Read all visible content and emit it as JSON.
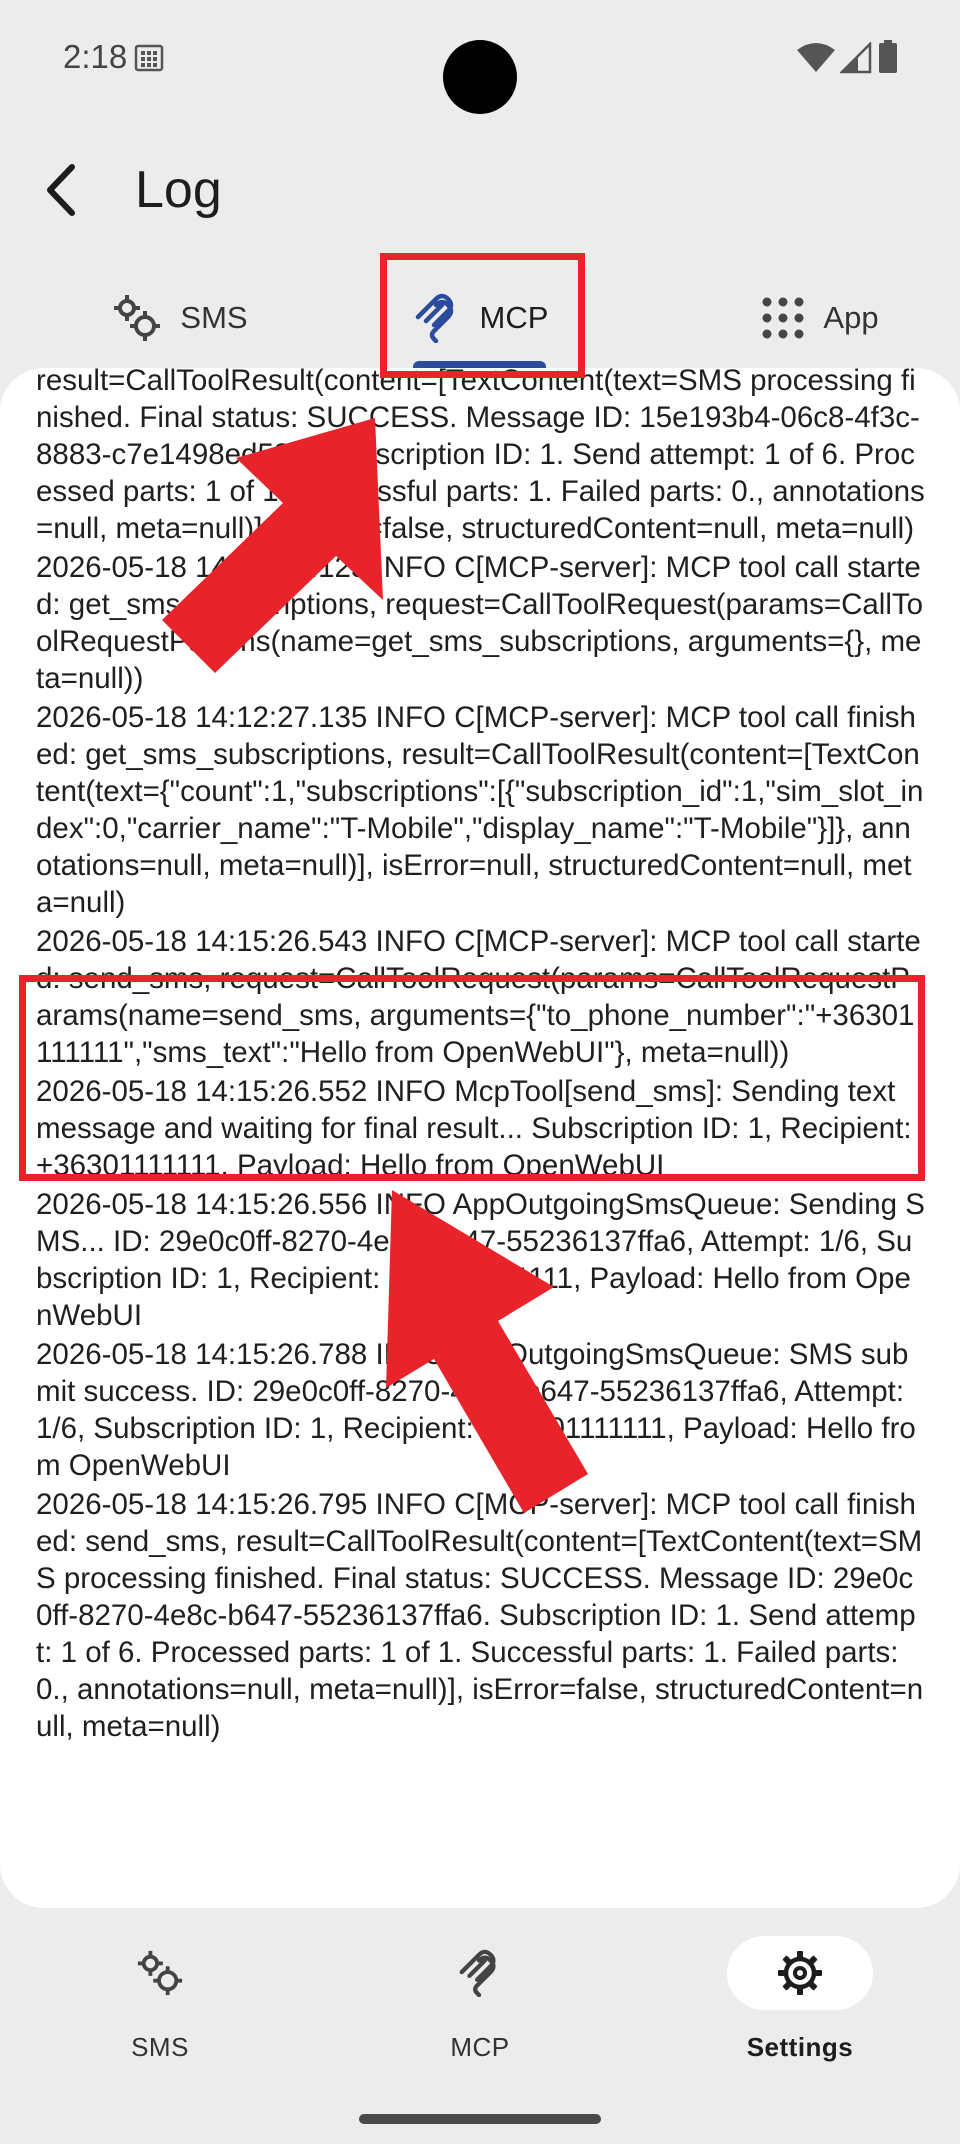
{
  "status_bar": {
    "time": "2:18"
  },
  "app_bar": {
    "title": "Log"
  },
  "tabs": [
    {
      "label": "SMS",
      "icon": "gears-icon"
    },
    {
      "label": "MCP",
      "icon": "mcp-logo-icon",
      "selected": true
    },
    {
      "label": "App",
      "icon": "grid-dots-icon"
    }
  ],
  "log_entries": [
    "result=CallToolResult(content=[TextContent(text=SMS processing finished. Final status: SUCCESS. Message ID: 15e193b4-06c8-4f3c-8883-c7e1498ed539. Subscription ID: 1. Send attempt: 1 of 6. Processed parts: 1 of 1. Successful parts: 1. Failed parts: 0., annotations=null, meta=null)], isError=false, structuredContent=null, meta=null)",
    "2026-05-18 14:12:27.125 INFO C[MCP-server]: MCP tool call started: get_sms_subscriptions, request=CallToolRequest(params=CallToolRequestParams(name=get_sms_subscriptions, arguments={}, meta=null))",
    "2026-05-18 14:12:27.135 INFO C[MCP-server]: MCP tool call finished: get_sms_subscriptions, result=CallToolResult(content=[TextContent(text={\"count\":1,\"subscriptions\":[{\"subscription_id\":1,\"sim_slot_index\":0,\"carrier_name\":\"T-Mobile\",\"display_name\":\"T-Mobile\"}]}, annotations=null, meta=null)], isError=null, structuredContent=null, meta=null)",
    "2026-05-18 14:15:26.543 INFO C[MCP-server]: MCP tool call started: send_sms, request=CallToolRequest(params=CallToolRequestParams(name=send_sms, arguments={\"to_phone_number\":\"+36301111111\",\"sms_text\":\"Hello from OpenWebUI\"}, meta=null))",
    "2026-05-18 14:15:26.552 INFO McpTool[send_sms]: Sending text message and waiting for final result... Subscription ID: 1, Recipient: +36301111111, Payload: Hello from OpenWebUI",
    "2026-05-18 14:15:26.556 INFO AppOutgoingSmsQueue: Sending SMS... ID: 29e0c0ff-8270-4e8c-b647-55236137ffa6, Attempt: 1/6, Subscription ID: 1, Recipient: +36301111111, Payload: Hello from OpenWebUI",
    "2026-05-18 14:15:26.788 INFO AppOutgoingSmsQueue: SMS submit success. ID: 29e0c0ff-8270-4e8c-b647-55236137ffa6, Attempt: 1/6, Subscription ID: 1, Recipient: +36301111111, Payload: Hello from OpenWebUI",
    "2026-05-18 14:15:26.795 INFO C[MCP-server]: MCP tool call finished: send_sms, result=CallToolResult(content=[TextContent(text=SMS processing finished. Final status: SUCCESS. Message ID: 29e0c0ff-8270-4e8c-b647-55236137ffa6. Subscription ID: 1. Send attempt: 1 of 6. Processed parts: 1 of 1. Successful parts: 1. Failed parts: 0., annotations=null, meta=null)], isError=false, structuredContent=null, meta=null)"
  ],
  "bottom_nav": [
    {
      "label": "SMS",
      "icon": "gears-icon"
    },
    {
      "label": "MCP",
      "icon": "mcp-logo-icon"
    },
    {
      "label": "Settings",
      "icon": "settings-gear-icon",
      "selected": true
    }
  ],
  "colors": {
    "annotation_red": "#e8232a",
    "tab_indicator": "#2b4c9c"
  }
}
